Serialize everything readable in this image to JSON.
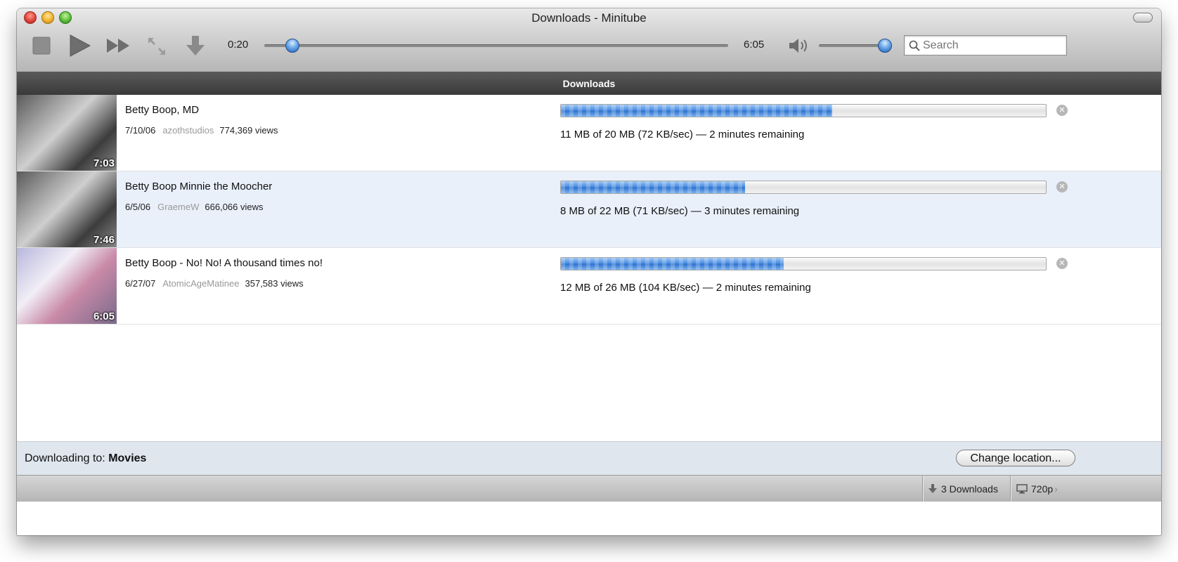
{
  "window": {
    "title": "Downloads - Minitube"
  },
  "player": {
    "elapsed": "0:20",
    "total": "6:05",
    "seek_progress": 0.06,
    "volume_level": 0.9
  },
  "search": {
    "placeholder": "Search"
  },
  "section": {
    "title": "Downloads"
  },
  "downloads": [
    {
      "title": "Betty Boop, MD",
      "date": "7/10/06",
      "author": "azothstudios",
      "views": "774,369 views",
      "duration": "7:03",
      "progress": 0.56,
      "status": "11 MB of 20 MB (72 KB/sec) — 2 minutes remaining",
      "selected": false
    },
    {
      "title": "Betty Boop Minnie the Moocher",
      "date": "6/5/06",
      "author": "GraemeW",
      "views": "666,066 views",
      "duration": "7:46",
      "progress": 0.38,
      "status": "8 MB of 22 MB (71 KB/sec) — 3 minutes remaining",
      "selected": true
    },
    {
      "title": "Betty Boop - No! No! A thousand times no!",
      "date": "6/27/07",
      "author": "AtomicAgeMatinee",
      "views": "357,583 views",
      "duration": "6:05",
      "progress": 0.46,
      "status": "12 MB of 26 MB (104 KB/sec) — 2 minutes remaining",
      "selected": false
    }
  ],
  "footer": {
    "downloading_to_label": "Downloading to:",
    "folder": "Movies",
    "change_location_label": "Change location..."
  },
  "statusbar": {
    "downloads_label": "3 Downloads",
    "quality_label": "720p"
  },
  "colors": {
    "accent": "#3f86e0",
    "selected_row": "#e9f0fa",
    "header_bar": "#4a4a4a"
  },
  "icons": [
    "stop-icon",
    "play-icon",
    "skip-icon",
    "fullscreen-icon",
    "download-icon",
    "volume-icon",
    "search-icon",
    "cancel-icon",
    "monitor-icon"
  ]
}
